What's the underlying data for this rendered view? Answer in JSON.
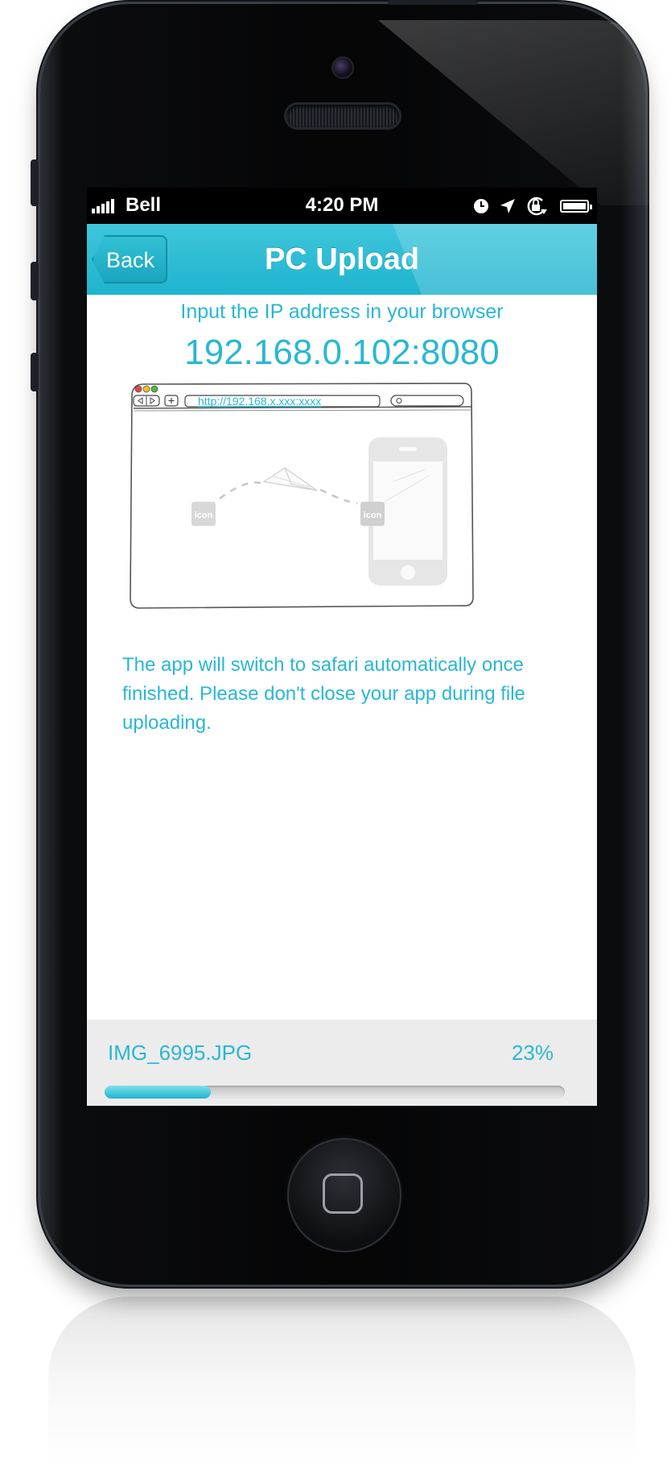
{
  "status_bar": {
    "carrier": "Bell",
    "time": "4:20 PM"
  },
  "nav": {
    "back_label": "Back",
    "title": "PC Upload"
  },
  "instructions": {
    "prompt": "Input the IP address in your browser",
    "ip_address": "192.168.0.102:8080"
  },
  "illustration": {
    "url": "http://192.168.x.xxx:xxxx",
    "icon_label": "icon"
  },
  "info_text": "The app will switch to safari automatically once finished. Please don't close your app during file uploading.",
  "upload": {
    "file_name": "IMG_6995.JPG",
    "percent_label": "23%",
    "progress": 0.23
  },
  "colors": {
    "accent": "#29b7d3",
    "nav_bar": "#1fb3cd",
    "panel_bg": "#ececec"
  },
  "icons": [
    "signal-icon",
    "clock-icon",
    "location-arrow-icon",
    "rotation-lock-icon",
    "battery-icon",
    "home-button-icon"
  ]
}
